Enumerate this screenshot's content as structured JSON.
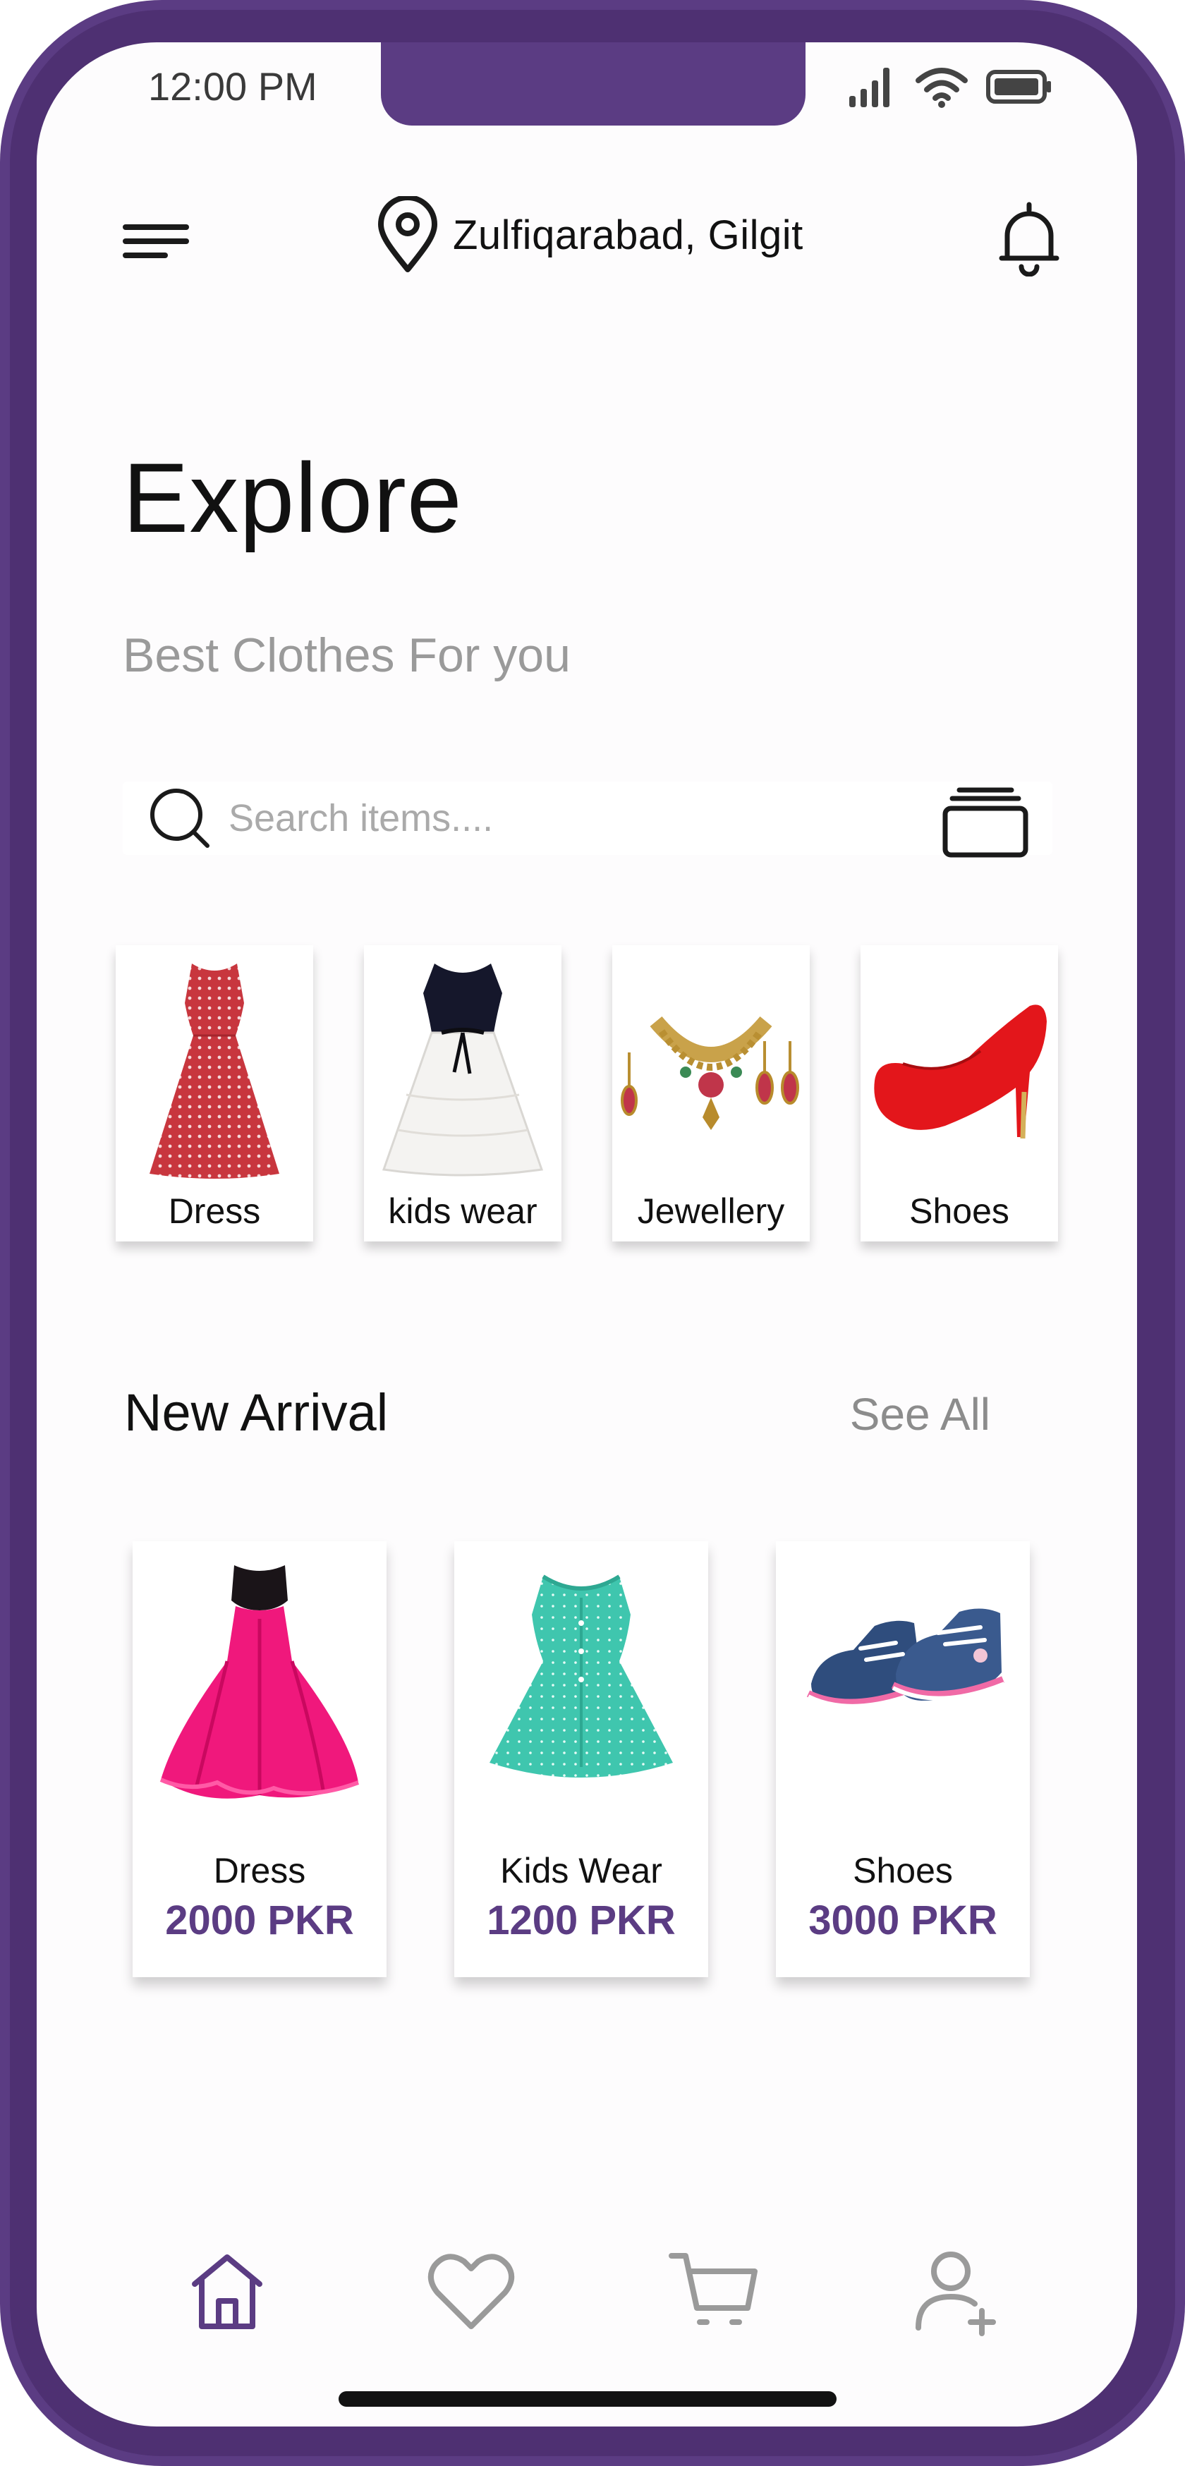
{
  "status_bar": {
    "time": "12:00 PM"
  },
  "header": {
    "location": "Zulfiqarabad, Gilgit",
    "menu_icon": "menu-icon",
    "location_icon": "map-pin-icon",
    "bell_icon": "bell-icon"
  },
  "page": {
    "title": "Explore",
    "subtitle": "Best Clothes For you"
  },
  "search": {
    "placeholder": "Search items....",
    "value": ""
  },
  "categories": [
    {
      "label": "Dress",
      "icon": "red-polka-dress-image"
    },
    {
      "label": "kids wear",
      "icon": "kids-white-dress-image"
    },
    {
      "label": "Jewellery",
      "icon": "necklace-earrings-image"
    },
    {
      "label": "Shoes",
      "icon": "red-high-heel-image"
    }
  ],
  "new_arrival": {
    "title": "New Arrival",
    "see_all": "See All",
    "items": [
      {
        "name": "Dress",
        "price": "2000 PKR",
        "icon": "pink-gown-image"
      },
      {
        "name": "Kids Wear",
        "price": "1200 PKR",
        "icon": "teal-kids-dress-image"
      },
      {
        "name": "Shoes",
        "price": "3000 PKR",
        "icon": "denim-sneakers-image"
      }
    ]
  },
  "bottom_nav": [
    {
      "name": "home",
      "icon": "home-icon",
      "active": true
    },
    {
      "name": "favorites",
      "icon": "heart-icon",
      "active": false
    },
    {
      "name": "cart",
      "icon": "cart-icon",
      "active": false
    },
    {
      "name": "profile",
      "icon": "add-user-icon",
      "active": false
    }
  ],
  "colors": {
    "accent": "#5b3c83",
    "background": "#fdfcfd",
    "text": "#111111",
    "muted": "#9a9a9a"
  }
}
